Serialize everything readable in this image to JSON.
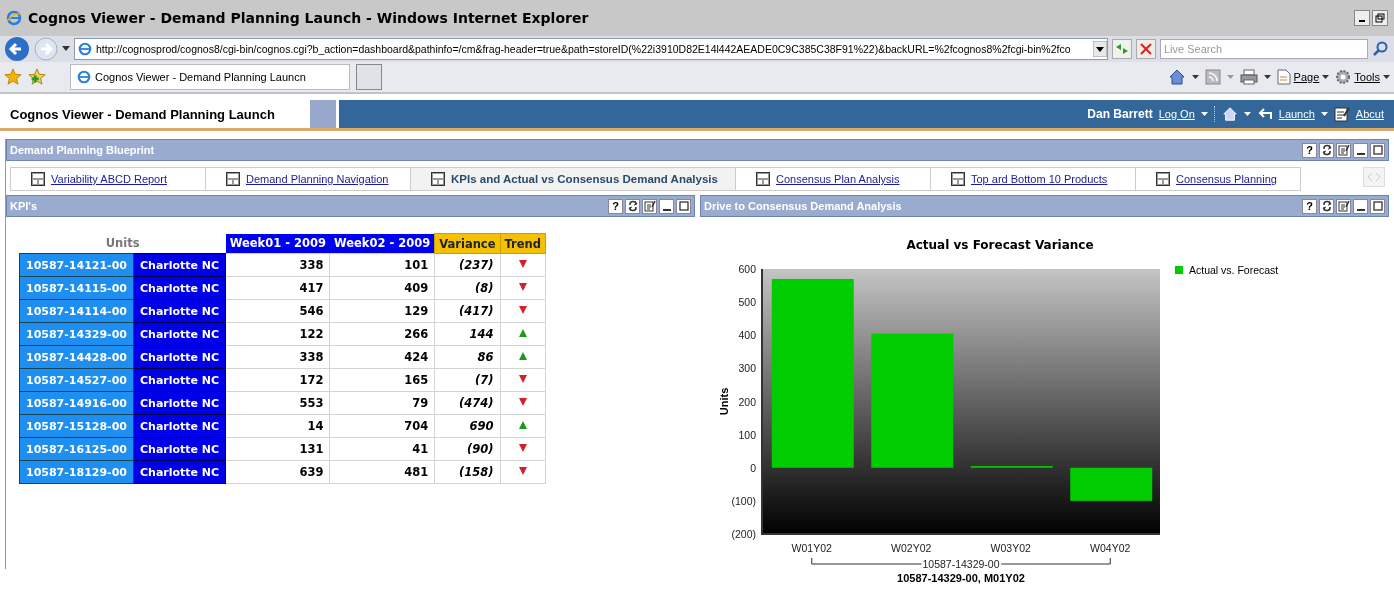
{
  "window": {
    "title": "Cognos Viewer - Demand Planning Launch - Windows Internet Explorer"
  },
  "address_bar": {
    "url": "http://cognosprod/cognos8/cgi-bin/cognos.cgi?b_action=dashboard&pathinfo=/cm&frag-header=true&path=storeID(%22i3910D82E14l442AEADE0C9C385C38F91%22)&backURL=%2fcognos8%2fcgi-bin%2fco",
    "search_placeholder": "Live Search"
  },
  "browser_tab": {
    "title": "Cognos Viewer - Demand Planning Launcn"
  },
  "command_bar": {
    "page": "Page",
    "tools": "Tools"
  },
  "app_header": {
    "title": "Cognos Viewer - Demand Planning Launch",
    "user": "Dan Barrett",
    "log_on": "Log On",
    "launch": "Launch",
    "about": "Abcut"
  },
  "portal": {
    "title": "Demand Planning Blueprint",
    "help": "?"
  },
  "tabs": [
    {
      "label": "Variability ABCD Report",
      "selected": false
    },
    {
      "label": "Demand Planning Navigation",
      "selected": false
    },
    {
      "label": "KPIs and Actual vs Consensus Demand Analysis",
      "selected": true
    },
    {
      "label": "Consensus Plan Analysis",
      "selected": false
    },
    {
      "label": "Top ard Bottom 10 Products",
      "selected": false
    },
    {
      "label": "Consensus Planning",
      "selected": false
    }
  ],
  "kpi_panel": {
    "title": "KPI's",
    "help": "?",
    "table": {
      "units_label": "Units",
      "columns": [
        "Week01 - 2009",
        "Week02 - 2009",
        "Variance",
        "Trend"
      ],
      "rows": [
        {
          "product": "10587-14121-00",
          "location": "Charlotte NC",
          "week01": "338",
          "week02": "101",
          "variance": "(237)",
          "trend_up": false
        },
        {
          "product": "10587-14115-00",
          "location": "Charlotte NC",
          "week01": "417",
          "week02": "409",
          "variance": "(8)",
          "trend_up": false
        },
        {
          "product": "10587-14114-00",
          "location": "Charlotte NC",
          "week01": "546",
          "week02": "129",
          "variance": "(417)",
          "trend_up": false
        },
        {
          "product": "10587-14329-00",
          "location": "Charlotte NC",
          "week01": "122",
          "week02": "266",
          "variance": "144",
          "trend_up": true
        },
        {
          "product": "10587-14428-00",
          "location": "Charlotte NC",
          "week01": "338",
          "week02": "424",
          "variance": "86",
          "trend_up": true
        },
        {
          "product": "10587-14527-00",
          "location": "Charlotte NC",
          "week01": "172",
          "week02": "165",
          "variance": "(7)",
          "trend_up": false
        },
        {
          "product": "10587-14916-00",
          "location": "Charlotte NC",
          "week01": "553",
          "week02": "79",
          "variance": "(474)",
          "trend_up": false
        },
        {
          "product": "10587-15128-00",
          "location": "Charlotte NC",
          "week01": "14",
          "week02": "704",
          "variance": "690",
          "trend_up": true
        },
        {
          "product": "10587-16125-00",
          "location": "Charlotte NC",
          "week01": "131",
          "week02": "41",
          "variance": "(90)",
          "trend_up": false
        },
        {
          "product": "10587-18129-00",
          "location": "Charlotte NC",
          "week01": "639",
          "week02": "481",
          "variance": "(158)",
          "trend_up": false
        }
      ]
    }
  },
  "chart_panel": {
    "title": "Drive to Consensus Demand Analysis",
    "help": "?",
    "group_label": "10587-14329-00",
    "chart_data": {
      "type": "bar",
      "title": "Actual vs Forecast Variance",
      "xlabel": "10587-14329-00, M01Y02",
      "ylabel": "Units",
      "categories": [
        "W01Y02",
        "W02Y02",
        "W03Y02",
        "W04Y02"
      ],
      "series": [
        {
          "name": "Actual vs. Forecast",
          "color": "#00cc00",
          "values": [
            570,
            405,
            5,
            -100
          ]
        }
      ],
      "ylim": [
        -200,
        600
      ],
      "yticks": [
        {
          "value": -200,
          "label": "(200)"
        },
        {
          "value": -100,
          "label": "(100)"
        },
        0,
        100,
        200,
        300,
        400,
        500,
        600
      ]
    }
  }
}
